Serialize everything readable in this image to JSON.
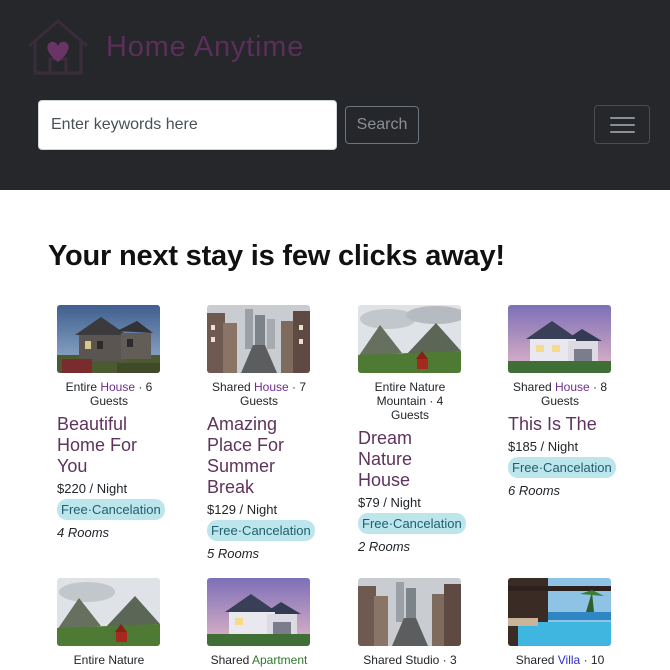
{
  "brand": {
    "name": "Home Anytime"
  },
  "search": {
    "placeholder": "Enter keywords here",
    "value": "",
    "button_label": "Search"
  },
  "heading": "Your next stay is few clicks away!",
  "colors": {
    "navbar": "#25272b",
    "brand": "#5b2f5a",
    "title": "#5e335d",
    "badge": "#bde5ec"
  },
  "listings": [
    {
      "prefix": "Entire ",
      "type": "House",
      "suffix": " · 6 Guests",
      "title": "Beautiful Home For You",
      "price": "$220 / Night",
      "badge": "Free·Cancelation",
      "rooms": "4 Rooms",
      "image": "old-house-photo"
    },
    {
      "prefix": "Shared ",
      "type": "House",
      "suffix": " · 7 Guests",
      "title": "Amazing Place For Summer Break",
      "price": "$129 / Night",
      "badge": "Free·Cancelation",
      "rooms": "5 Rooms",
      "image": "city-street-photo"
    },
    {
      "prefix": "Entire Nature Mountain",
      "type": "",
      "suffix": " · 4 Guests",
      "title": "Dream Nature House",
      "price": "$79 / Night",
      "badge": "Free·Cancelation",
      "rooms": "2 Rooms",
      "image": "mountain-cabin-photo"
    },
    {
      "prefix": "Shared ",
      "type": "House",
      "suffix": " · 8 Guests",
      "title": "This Is The",
      "price": "$185 / Night",
      "badge": "Free·Cancelation",
      "rooms": "6 Rooms",
      "image": "suburban-house-photo"
    },
    {
      "prefix": "Entire Nature",
      "type": "",
      "suffix": "",
      "image": "mountain-cabin-photo"
    },
    {
      "prefix": "Shared ",
      "type": "Apartment",
      "suffix": "",
      "image": "suburban-house-photo"
    },
    {
      "prefix": "Shared Studio · 3",
      "type": "",
      "suffix": "",
      "image": "city-street-photo"
    },
    {
      "prefix": "Shared ",
      "type": "Villa",
      "suffix": " · 10",
      "image": "pool-villa-photo"
    }
  ]
}
